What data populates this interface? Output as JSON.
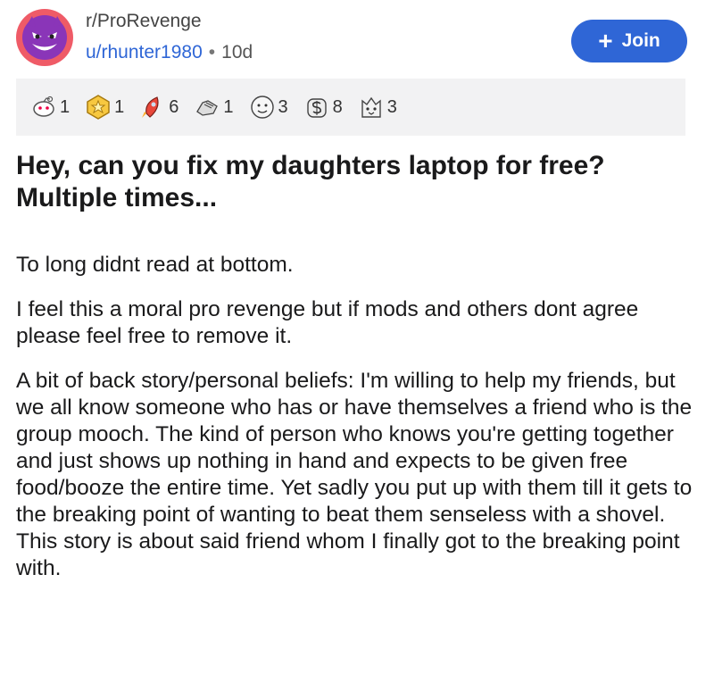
{
  "post": {
    "subreddit": "r/ProRevenge",
    "username": "u/rhunter1980",
    "separator": "•",
    "age": "10d",
    "join_label": "Join",
    "join_icon": "+",
    "title": "Hey, can you fix my daughters laptop for free? Multiple times...",
    "paragraphs": [
      "To long didnt read at bottom.",
      "I feel this a moral pro revenge but if mods and others dont agree please feel free to remove it.",
      "A bit of back story/personal beliefs: I'm willing to help my friends, but we all know someone who has or have themselves a friend who is the group mooch. The kind of person who knows you're getting together and just shows up nothing in hand and expects to be given free food/booze the entire time. Yet sadly you put up with them till it gets to the breaking point of wanting to beat them senseless with a shovel. This story is about said friend whom I finally got to the breaking point with."
    ]
  },
  "awards": [
    {
      "icon": "snoo-award-icon",
      "count": "1"
    },
    {
      "icon": "gold-star-award-icon",
      "count": "1"
    },
    {
      "icon": "rocket-award-icon",
      "count": "6"
    },
    {
      "icon": "hand-award-icon",
      "count": "1"
    },
    {
      "icon": "face-award-icon",
      "count": "3"
    },
    {
      "icon": "money-bag-award-icon",
      "count": "8"
    },
    {
      "icon": "cat-face-award-icon",
      "count": "3"
    }
  ],
  "colors": {
    "accent": "#2f66d6",
    "avatar": "#ef5b67",
    "award_bar": "#f2f2f3"
  }
}
